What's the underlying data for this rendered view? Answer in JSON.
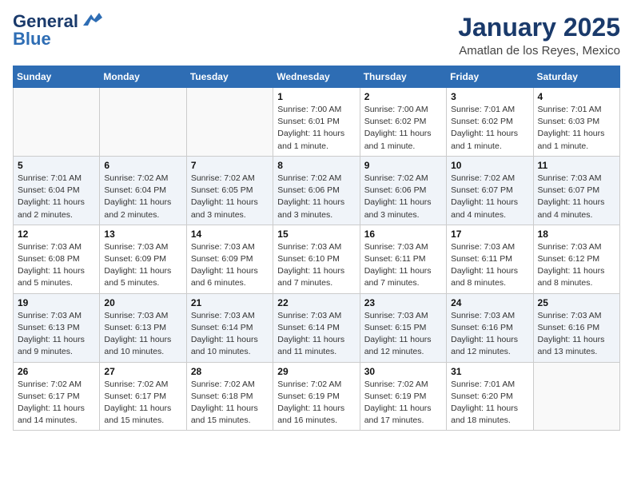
{
  "header": {
    "logo_general": "General",
    "logo_blue": "Blue",
    "title": "January 2025",
    "subtitle": "Amatlan de los Reyes, Mexico"
  },
  "days_of_week": [
    "Sunday",
    "Monday",
    "Tuesday",
    "Wednesday",
    "Thursday",
    "Friday",
    "Saturday"
  ],
  "weeks": [
    [
      {
        "day": "",
        "info": ""
      },
      {
        "day": "",
        "info": ""
      },
      {
        "day": "",
        "info": ""
      },
      {
        "day": "1",
        "info": "Sunrise: 7:00 AM\nSunset: 6:01 PM\nDaylight: 11 hours and 1 minute."
      },
      {
        "day": "2",
        "info": "Sunrise: 7:00 AM\nSunset: 6:02 PM\nDaylight: 11 hours and 1 minute."
      },
      {
        "day": "3",
        "info": "Sunrise: 7:01 AM\nSunset: 6:02 PM\nDaylight: 11 hours and 1 minute."
      },
      {
        "day": "4",
        "info": "Sunrise: 7:01 AM\nSunset: 6:03 PM\nDaylight: 11 hours and 1 minute."
      }
    ],
    [
      {
        "day": "5",
        "info": "Sunrise: 7:01 AM\nSunset: 6:04 PM\nDaylight: 11 hours and 2 minutes."
      },
      {
        "day": "6",
        "info": "Sunrise: 7:02 AM\nSunset: 6:04 PM\nDaylight: 11 hours and 2 minutes."
      },
      {
        "day": "7",
        "info": "Sunrise: 7:02 AM\nSunset: 6:05 PM\nDaylight: 11 hours and 3 minutes."
      },
      {
        "day": "8",
        "info": "Sunrise: 7:02 AM\nSunset: 6:06 PM\nDaylight: 11 hours and 3 minutes."
      },
      {
        "day": "9",
        "info": "Sunrise: 7:02 AM\nSunset: 6:06 PM\nDaylight: 11 hours and 3 minutes."
      },
      {
        "day": "10",
        "info": "Sunrise: 7:02 AM\nSunset: 6:07 PM\nDaylight: 11 hours and 4 minutes."
      },
      {
        "day": "11",
        "info": "Sunrise: 7:03 AM\nSunset: 6:07 PM\nDaylight: 11 hours and 4 minutes."
      }
    ],
    [
      {
        "day": "12",
        "info": "Sunrise: 7:03 AM\nSunset: 6:08 PM\nDaylight: 11 hours and 5 minutes."
      },
      {
        "day": "13",
        "info": "Sunrise: 7:03 AM\nSunset: 6:09 PM\nDaylight: 11 hours and 5 minutes."
      },
      {
        "day": "14",
        "info": "Sunrise: 7:03 AM\nSunset: 6:09 PM\nDaylight: 11 hours and 6 minutes."
      },
      {
        "day": "15",
        "info": "Sunrise: 7:03 AM\nSunset: 6:10 PM\nDaylight: 11 hours and 7 minutes."
      },
      {
        "day": "16",
        "info": "Sunrise: 7:03 AM\nSunset: 6:11 PM\nDaylight: 11 hours and 7 minutes."
      },
      {
        "day": "17",
        "info": "Sunrise: 7:03 AM\nSunset: 6:11 PM\nDaylight: 11 hours and 8 minutes."
      },
      {
        "day": "18",
        "info": "Sunrise: 7:03 AM\nSunset: 6:12 PM\nDaylight: 11 hours and 8 minutes."
      }
    ],
    [
      {
        "day": "19",
        "info": "Sunrise: 7:03 AM\nSunset: 6:13 PM\nDaylight: 11 hours and 9 minutes."
      },
      {
        "day": "20",
        "info": "Sunrise: 7:03 AM\nSunset: 6:13 PM\nDaylight: 11 hours and 10 minutes."
      },
      {
        "day": "21",
        "info": "Sunrise: 7:03 AM\nSunset: 6:14 PM\nDaylight: 11 hours and 10 minutes."
      },
      {
        "day": "22",
        "info": "Sunrise: 7:03 AM\nSunset: 6:14 PM\nDaylight: 11 hours and 11 minutes."
      },
      {
        "day": "23",
        "info": "Sunrise: 7:03 AM\nSunset: 6:15 PM\nDaylight: 11 hours and 12 minutes."
      },
      {
        "day": "24",
        "info": "Sunrise: 7:03 AM\nSunset: 6:16 PM\nDaylight: 11 hours and 12 minutes."
      },
      {
        "day": "25",
        "info": "Sunrise: 7:03 AM\nSunset: 6:16 PM\nDaylight: 11 hours and 13 minutes."
      }
    ],
    [
      {
        "day": "26",
        "info": "Sunrise: 7:02 AM\nSunset: 6:17 PM\nDaylight: 11 hours and 14 minutes."
      },
      {
        "day": "27",
        "info": "Sunrise: 7:02 AM\nSunset: 6:17 PM\nDaylight: 11 hours and 15 minutes."
      },
      {
        "day": "28",
        "info": "Sunrise: 7:02 AM\nSunset: 6:18 PM\nDaylight: 11 hours and 15 minutes."
      },
      {
        "day": "29",
        "info": "Sunrise: 7:02 AM\nSunset: 6:19 PM\nDaylight: 11 hours and 16 minutes."
      },
      {
        "day": "30",
        "info": "Sunrise: 7:02 AM\nSunset: 6:19 PM\nDaylight: 11 hours and 17 minutes."
      },
      {
        "day": "31",
        "info": "Sunrise: 7:01 AM\nSunset: 6:20 PM\nDaylight: 11 hours and 18 minutes."
      },
      {
        "day": "",
        "info": ""
      }
    ]
  ]
}
